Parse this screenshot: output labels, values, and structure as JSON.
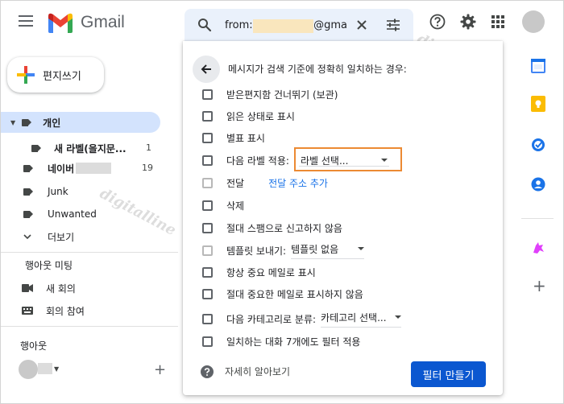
{
  "app": {
    "name": "Gmail"
  },
  "search": {
    "prefix": "from:",
    "suffix": "@gma"
  },
  "compose": {
    "label": "편지쓰기"
  },
  "sidebar": {
    "labels": [
      {
        "name": "개인",
        "active": true
      },
      {
        "name": "새 라벨(을지문...",
        "count": "1"
      },
      {
        "name": "네이버",
        "count": "19"
      },
      {
        "name": "Junk"
      },
      {
        "name": "Unwanted"
      }
    ],
    "more": "더보기",
    "meet": {
      "title": "행아웃 미팅",
      "new_meeting": "새 회의",
      "join_meeting": "회의 참여"
    },
    "hangouts": {
      "title": "행아웃"
    }
  },
  "filter_panel": {
    "title": "메시지가 검색 기준에 정확히 일치하는 경우:",
    "options": [
      "받은편지함 건너뛰기 (보관)",
      "읽은 상태로 표시",
      "별표 표시",
      "다음 라벨 적용:",
      "전달",
      "삭제",
      "절대 스팸으로 신고하지 않음",
      "템플릿 보내기:",
      "항상 중요 메일로 표시",
      "절대 중요한 메일로 표시하지 않음",
      "다음 카테고리로 분류:",
      "일치하는 대화 7개에도 필터 적용"
    ],
    "label_select": "라벨 선택...",
    "forward_link": "전달 주소 추가",
    "template_select": "템플릿 없음",
    "category_select": "카테고리 선택...",
    "learn_more": "자세히 알아보기",
    "create_button": "필터 만들기"
  },
  "watermark": "digitalline",
  "colors": {
    "active_label_bg": "#d3e3fd",
    "primary_button": "#0b57d0",
    "link": "#1a73e8",
    "highlight_box": "#ec8a33"
  }
}
